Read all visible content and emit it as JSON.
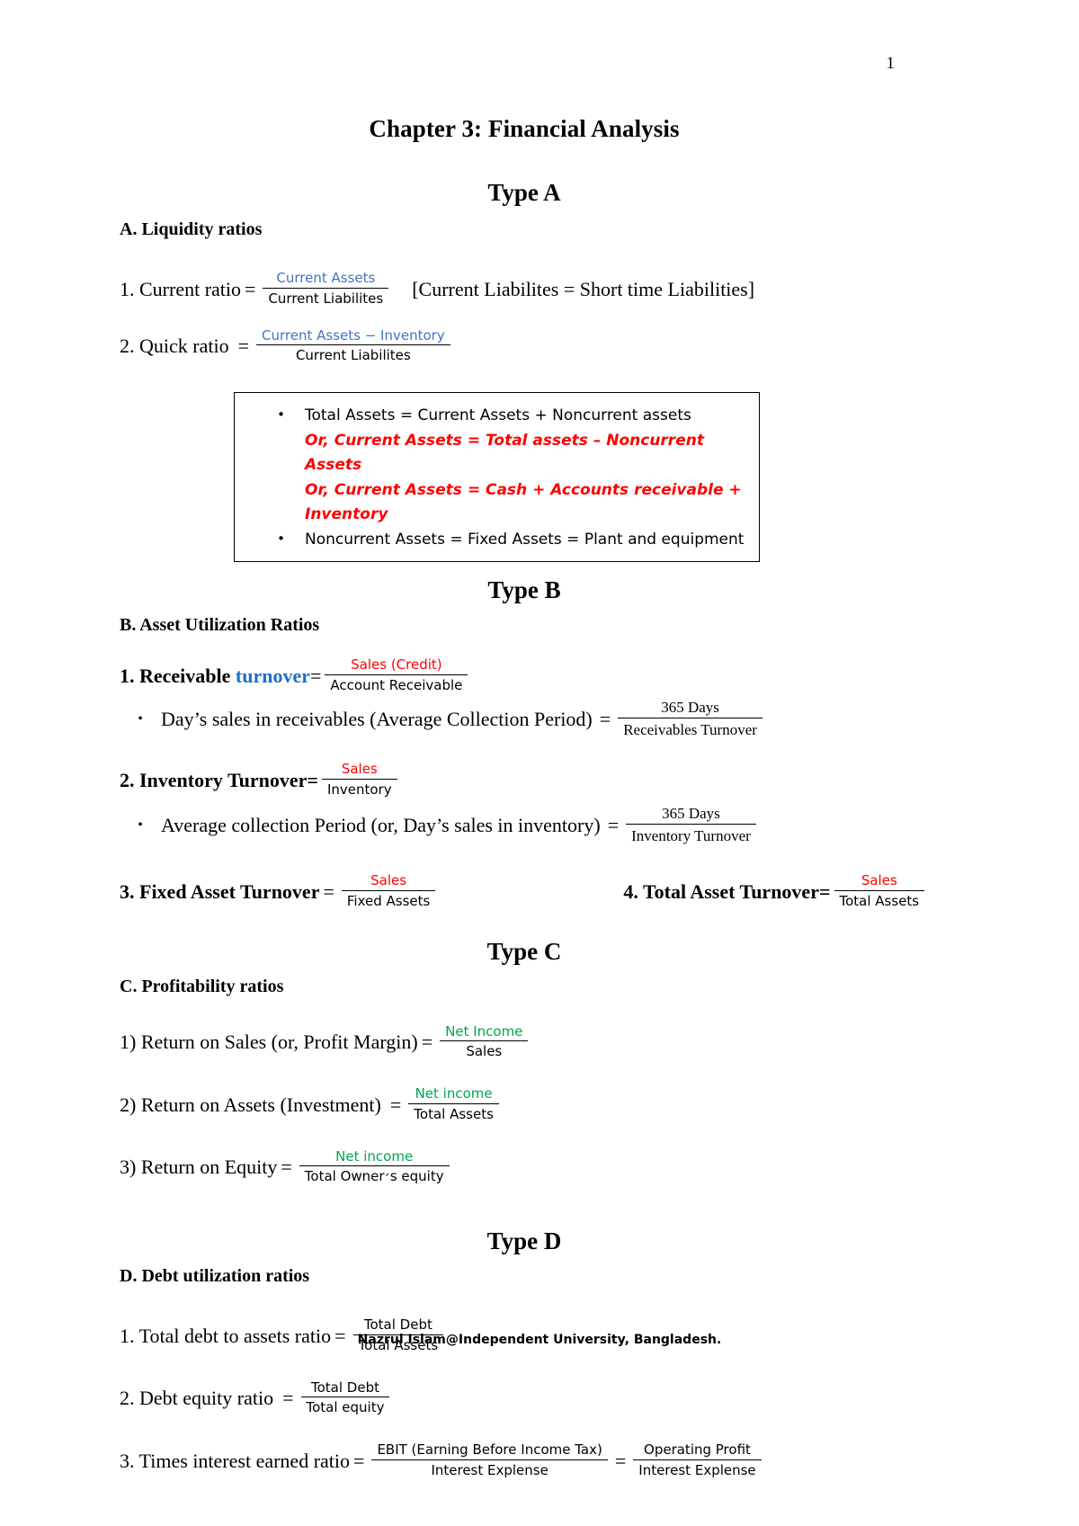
{
  "page": {
    "number": "1"
  },
  "title": "Chapter 3: Financial Analysis",
  "footer": "Nazrul Islam@Independent University, Bangladesh.",
  "colors": {
    "blue": "#4472C4",
    "blue_bold": "#1F6FC4",
    "red": "#FF0000",
    "green": "#00A550",
    "black": "#000000"
  },
  "sections": {
    "a": {
      "type_heading": "Type A",
      "heading": "A. Liquidity ratios",
      "item1": {
        "label": "1. Current ratio",
        "equals": "=",
        "numerator": "Current Assets",
        "denominator": "Current Liabilites",
        "note": "[Current Liabilites = Short time Liabilities]"
      },
      "item2": {
        "label": "2. Quick ratio",
        "equals": "=",
        "numerator": "Current Assets − Inventory",
        "denominator": "Current Liabilites"
      },
      "box": {
        "bullet1": "Total Assets = Current Assets + Noncurrent assets",
        "or1": "Or, Current Assets = Total assets – Noncurrent Assets",
        "or2": "Or, Current Assets = Cash + Accounts receivable + Inventory",
        "bullet2": "Noncurrent Assets = Fixed Assets = Plant and equipment",
        "dot": "•"
      }
    },
    "b": {
      "type_heading": "Type B",
      "heading": "B. Asset Utilization Ratios",
      "item1": {
        "label_pre": "1. Receivable ",
        "label_hi": "turnover",
        "equals": "=",
        "numerator": "Sales (Credit)",
        "denominator": "Account Receivable"
      },
      "sub1": {
        "dot": "•",
        "label": "Day’s sales in receivables (Average Collection Period)",
        "equals": "=",
        "numerator": "365 Days",
        "denominator": "Receivables Turnover"
      },
      "item2": {
        "label": "2. Inventory Turnover=",
        "numerator": "Sales",
        "denominator": "Inventory"
      },
      "sub2": {
        "dot": "•",
        "label": "Average collection Period (or, Day’s sales in inventory)",
        "equals": "=",
        "numerator": "365 Days",
        "denominator": "Inventory Turnover"
      },
      "item3": {
        "label": "3. Fixed Asset Turnover",
        "equals": "=",
        "numerator": "Sales",
        "denominator": "Fixed Assets"
      },
      "item4": {
        "label": "4. Total Asset Turnover=",
        "numerator": "Sales",
        "denominator": "Total Assets"
      }
    },
    "c": {
      "type_heading": "Type C",
      "heading": "C. Profitability ratios",
      "item1": {
        "label": "1) Return on Sales (or, Profit Margin)",
        "equals": "=",
        "numerator": "Net Income",
        "denominator": "Sales"
      },
      "item2": {
        "label": "2) Return on Assets (Investment)",
        "equals": "=",
        "numerator": "Net income",
        "denominator": "Total Assets"
      },
      "item3": {
        "label": "3) Return on Equity",
        "equals": "=",
        "numerator": "Net income",
        "denominator": "Total Owner׳s equity"
      }
    },
    "d": {
      "type_heading": "Type D",
      "heading": "D. Debt utilization ratios",
      "item1": {
        "label": "1. Total debt to assets ratio",
        "equals": "=",
        "numerator": "Total Debt",
        "denominator": "Total Assets"
      },
      "item2": {
        "label": "2. Debt equity ratio",
        "equals": "=",
        "numerator": "Total Debt",
        "denominator": "Total equity"
      },
      "item3": {
        "label": "3. Times interest earned ratio",
        "equals": "=",
        "numerator": "EBIT (Earning Before Income Tax)",
        "denominator": "Interest Explense",
        "equals2": "=",
        "numerator2": "Operating Profit",
        "denominator2": "Interest Explense"
      }
    }
  }
}
